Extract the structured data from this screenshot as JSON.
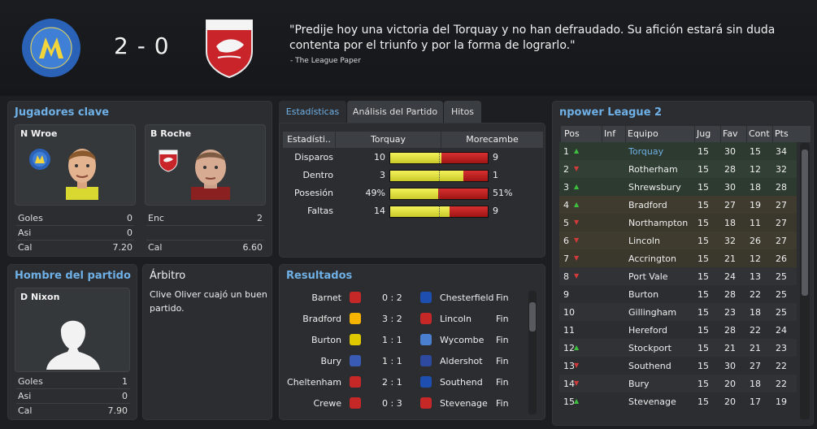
{
  "header": {
    "score": "2 - 0",
    "quote": "\"Predije hoy una victoria del Torquay y no han defraudado. Su afición estará sin duda contenta por el triunfo y por la forma de lograrlo.\"",
    "quote_source": "- The League Paper",
    "home_crest_text": "TORQUAY UNITED FOOTBALL CLUB",
    "away_crest_text": "MORECAMBE FC"
  },
  "key_players": {
    "title": "Jugadores clave",
    "home": {
      "name": "N Wroe",
      "stats": [
        {
          "label": "Goles",
          "value": "0"
        },
        {
          "label": "Asi",
          "value": "0"
        },
        {
          "label": "Cal",
          "value": "7.20"
        }
      ]
    },
    "away": {
      "name": "B Roche",
      "stats": [
        {
          "label": "Enc",
          "value": "2"
        },
        {
          "label": "Cal",
          "value": "6.60"
        }
      ]
    }
  },
  "motm": {
    "title": "Hombre del partido",
    "name": "D Nixon",
    "stats": [
      {
        "label": "Goles",
        "value": "1"
      },
      {
        "label": "Asi",
        "value": "0"
      },
      {
        "label": "Cal",
        "value": "7.90"
      }
    ]
  },
  "referee": {
    "title": "Árbitro",
    "text": "Clive Oliver cuajó un buen partido."
  },
  "tabs": [
    "Estadísticas",
    "Análisis del Partido",
    "Hitos"
  ],
  "stats": {
    "headers": [
      "Estadísti..",
      "Torquay",
      "Morecambe"
    ],
    "rows": [
      {
        "label": "Disparos",
        "home": "10",
        "away": "9",
        "home_share": 0.526
      },
      {
        "label": "Dentro",
        "home": "3",
        "away": "1",
        "home_share": 0.75
      },
      {
        "label": "Posesión",
        "home": "49%",
        "away": "51%",
        "home_share": 0.49
      },
      {
        "label": "Faltas",
        "home": "14",
        "away": "9",
        "home_share": 0.609
      }
    ]
  },
  "results": {
    "title": "Resultados",
    "rows": [
      {
        "home": "Barnet",
        "score": "0 : 2",
        "away": "Chesterfield",
        "status": "Fin",
        "hc": "#c62828",
        "ac": "#1e4fb0"
      },
      {
        "home": "Bradford",
        "score": "3 : 2",
        "away": "Lincoln",
        "status": "Fin",
        "hc": "#f5b400",
        "ac": "#c62828"
      },
      {
        "home": "Burton",
        "score": "1 : 1",
        "away": "Wycombe",
        "status": "Fin",
        "hc": "#e0c800",
        "ac": "#4a7fd0"
      },
      {
        "home": "Bury",
        "score": "1 : 1",
        "away": "Aldershot",
        "status": "Fin",
        "hc": "#3a5bb5",
        "ac": "#2e4a9e"
      },
      {
        "home": "Cheltenham",
        "score": "2 : 1",
        "away": "Southend",
        "status": "Fin",
        "hc": "#c62828",
        "ac": "#1e4fb0"
      },
      {
        "home": "Crewe",
        "score": "0 : 3",
        "away": "Stevenage",
        "status": "Fin",
        "hc": "#c62828",
        "ac": "#c62828"
      }
    ]
  },
  "league": {
    "title": "npower League 2",
    "headers": [
      "Pos",
      "Inf",
      "Equipo",
      "Jug",
      "Fav",
      "Cont",
      "Pts"
    ],
    "rows": [
      {
        "pos": "1",
        "arrow": "▲",
        "team": "Torquay",
        "j": "15",
        "f": "30",
        "c": "15",
        "p": "34"
      },
      {
        "pos": "2",
        "arrow": "▼",
        "team": "Rotherham",
        "j": "15",
        "f": "28",
        "c": "12",
        "p": "32"
      },
      {
        "pos": "3",
        "arrow": "▲",
        "team": "Shrewsbury",
        "j": "15",
        "f": "30",
        "c": "18",
        "p": "28"
      },
      {
        "pos": "4",
        "arrow": "▲",
        "team": "Bradford",
        "j": "15",
        "f": "27",
        "c": "19",
        "p": "27"
      },
      {
        "pos": "5",
        "arrow": "▼",
        "team": "Northampton",
        "j": "15",
        "f": "18",
        "c": "11",
        "p": "27"
      },
      {
        "pos": "6",
        "arrow": "▼",
        "team": "Lincoln",
        "j": "15",
        "f": "32",
        "c": "26",
        "p": "27"
      },
      {
        "pos": "7",
        "arrow": "▼",
        "team": "Accrington",
        "j": "15",
        "f": "21",
        "c": "12",
        "p": "26"
      },
      {
        "pos": "8",
        "arrow": "▼",
        "team": "Port Vale",
        "j": "15",
        "f": "24",
        "c": "13",
        "p": "25"
      },
      {
        "pos": "9",
        "arrow": "",
        "team": "Burton",
        "j": "15",
        "f": "28",
        "c": "22",
        "p": "25"
      },
      {
        "pos": "10",
        "arrow": "",
        "team": "Gillingham",
        "j": "15",
        "f": "23",
        "c": "18",
        "p": "25"
      },
      {
        "pos": "11",
        "arrow": "",
        "team": "Hereford",
        "j": "15",
        "f": "28",
        "c": "22",
        "p": "24"
      },
      {
        "pos": "12",
        "arrow": "▲",
        "team": "Stockport",
        "j": "15",
        "f": "21",
        "c": "21",
        "p": "23"
      },
      {
        "pos": "13",
        "arrow": "▼",
        "team": "Southend",
        "j": "15",
        "f": "30",
        "c": "27",
        "p": "22"
      },
      {
        "pos": "14",
        "arrow": "▼",
        "team": "Bury",
        "j": "15",
        "f": "20",
        "c": "18",
        "p": "22"
      },
      {
        "pos": "15",
        "arrow": "▲",
        "team": "Stevenage",
        "j": "15",
        "f": "20",
        "c": "17",
        "p": "19"
      }
    ]
  },
  "colors": {
    "accent": "#6fb0e6",
    "promotion": "#2f3d33",
    "playoff": "#3d3a2e",
    "arrow_up": "#3fbf3f",
    "arrow_down": "#d23b3b",
    "bar_home": "#e8e844",
    "bar_away": "#c21f1f"
  }
}
